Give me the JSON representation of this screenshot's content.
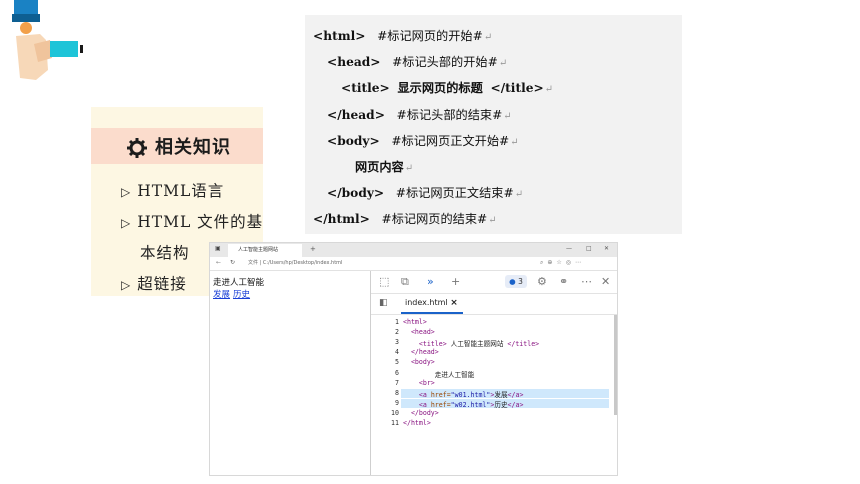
{
  "knowledge": {
    "title": "相关知识",
    "items": [
      "HTML语言",
      "HTML 文件的基",
      "本结构",
      "超链接"
    ]
  },
  "code_lines": [
    {
      "tag": "<html>",
      "comment": "#标记网页的开始#"
    },
    {
      "tag": "<head>",
      "comment": "#标记头部的开始#"
    },
    {
      "tag": "<title>",
      "text": "显示网页的标题",
      "close": "</title>"
    },
    {
      "tag": "</head>",
      "comment": "#标记头部的结束#"
    },
    {
      "tag": "<body>",
      "comment": "#标记网页正文开始#"
    },
    {
      "text": "网页内容"
    },
    {
      "tag": "</body>",
      "comment": "#标记网页正文结束#"
    },
    {
      "tag": "</html>",
      "comment": "#标记网页的结束#"
    }
  ],
  "return_mark": "↵",
  "browser": {
    "tab_title": "人工智能主题网站",
    "address_label": "文件",
    "address": "C:/Users/hp/Desktop/index.html",
    "page_heading": "走进人工智能",
    "links": [
      "发展",
      "历史"
    ],
    "devtools": {
      "issues_count": "3",
      "file_tab": "index.html",
      "close_glyph": "×",
      "line_numbers": [
        "1",
        "2",
        "3",
        "4",
        "5",
        "6",
        "7",
        "8",
        "9",
        "10",
        "11"
      ],
      "source": [
        {
          "indent": "",
          "a": "<html>"
        },
        {
          "indent": "  ",
          "a": "<head>"
        },
        {
          "indent": "    ",
          "a": "<title>",
          "t": " 人工智能主题网站 ",
          "b": "</title>"
        },
        {
          "indent": "  ",
          "a": "</head>"
        },
        {
          "indent": "  ",
          "a": "<body>"
        },
        {
          "indent": "        ",
          "t": "走进人工智能"
        },
        {
          "indent": "    ",
          "a": "<br>"
        },
        {
          "indent": "    ",
          "a": "<a ",
          "attr": "href=",
          "val": "\"w01.html\"",
          "a2": ">",
          "t": "发展",
          "b": "</a>"
        },
        {
          "indent": "    ",
          "a": "<a ",
          "attr": "href=",
          "val": "\"w02.html\"",
          "a2": ">",
          "t": "历史",
          "b": "</a>"
        },
        {
          "indent": "  ",
          "a": "</body>"
        },
        {
          "indent": "",
          "a": "</html>"
        }
      ]
    }
  }
}
